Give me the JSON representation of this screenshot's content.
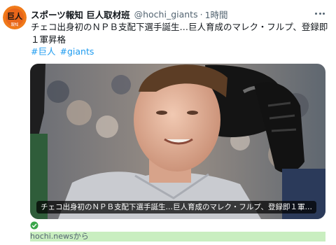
{
  "tweet": {
    "avatar_text": "巨人",
    "avatar_subtext": "報知",
    "author_name": "スポーツ報知 巨人取材班",
    "handle": "@hochi_giants",
    "separator": "·",
    "time": "1時間",
    "text_line1": "チェコ出身初のＮＰＢ支配下選手誕生…巨人育成のマレク・フルプ、登録即",
    "text_line2": "１軍昇格",
    "hashtags": [
      "#巨人",
      "#giants"
    ]
  },
  "card": {
    "caption": "チェコ出身初のＮＰＢ支配下選手誕生…巨人育成のマレク・フルプ、登録即１軍…",
    "source": "hochi.newsから"
  },
  "colors": {
    "avatar_bg": "#f07a1a",
    "link": "#1d9bf0",
    "secondary_text": "#536471",
    "source_highlight": "#c9eec0",
    "check": "#3aa64a"
  },
  "icons": {
    "more": "more-dots-icon",
    "check": "check-circle-icon"
  }
}
